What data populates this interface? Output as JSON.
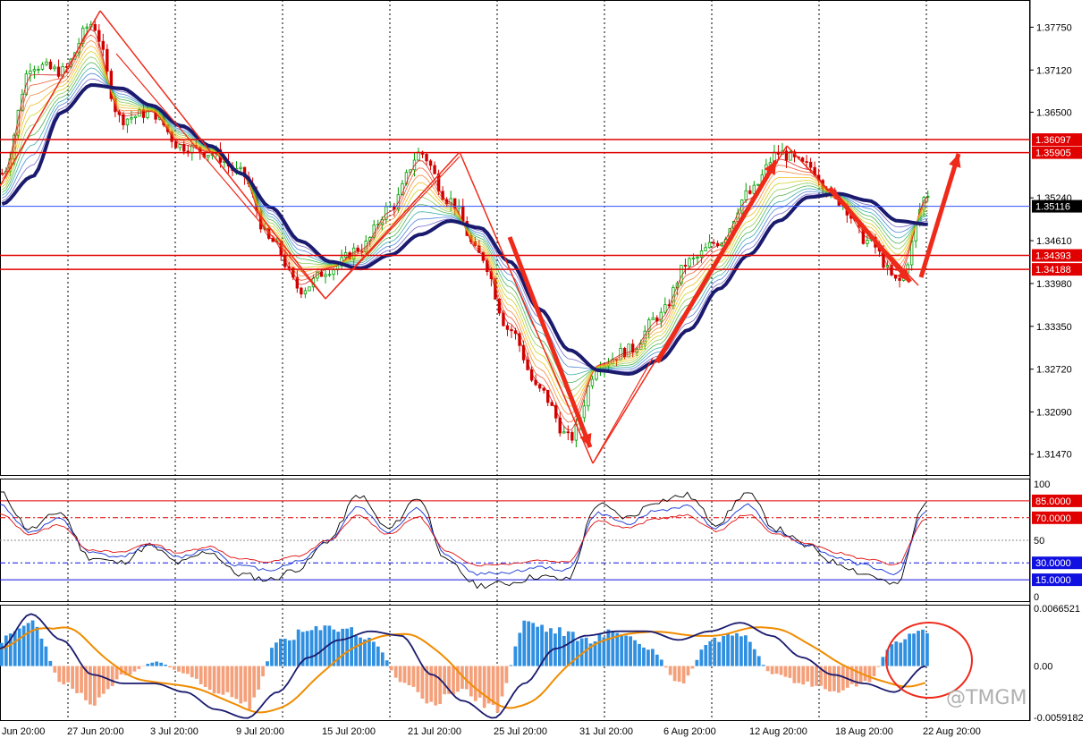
{
  "chart_data": [
    {
      "type": "candlestick",
      "panel": "price",
      "ylim": [
        1.3115,
        1.3815
      ],
      "y_ticks": [
        "1.37750",
        "1.37120",
        "1.36500",
        "1.35240",
        "1.34610",
        "1.33980",
        "1.33350",
        "1.32720",
        "1.32090",
        "1.31470"
      ],
      "horizontal_levels": [
        {
          "value": 1.36097,
          "label": "1.36097",
          "color": "#e00000"
        },
        {
          "value": 1.35905,
          "label": "1.35905",
          "color": "#e00000"
        },
        {
          "value": 1.35116,
          "label": "1.35116",
          "color": "#000000",
          "line_color": "#3050ff"
        },
        {
          "value": 1.34393,
          "label": "1.34393",
          "color": "#e00000"
        },
        {
          "value": 1.34188,
          "label": "1.34188",
          "color": "#e00000"
        }
      ],
      "ma_anchor_values": [
        1.3515,
        1.3555,
        1.365,
        1.369,
        1.3685,
        1.366,
        1.363,
        1.36,
        1.356,
        1.351,
        1.346,
        1.343,
        1.342,
        1.344,
        1.347,
        1.349,
        1.348,
        1.343,
        1.336,
        1.33,
        1.327,
        1.3265,
        1.3285,
        1.333,
        1.339,
        1.344,
        1.349,
        1.3525,
        1.353,
        1.352,
        1.349,
        1.3485
      ],
      "close_anchor_values": [
        1.356,
        1.372,
        1.371,
        1.378,
        1.364,
        1.365,
        1.36,
        1.359,
        1.356,
        1.346,
        1.339,
        1.342,
        1.345,
        1.351,
        1.359,
        1.352,
        1.344,
        1.333,
        1.324,
        1.317,
        1.328,
        1.33,
        1.335,
        1.343,
        1.346,
        1.353,
        1.359,
        1.357,
        1.352,
        1.346,
        1.34,
        1.353
      ]
    },
    {
      "type": "line",
      "panel": "oscillator",
      "ylim": [
        0,
        100
      ],
      "y_ticks": [
        "100",
        "50",
        "0"
      ],
      "levels": [
        {
          "value": 85,
          "label": "85.0000",
          "color": "#e00000"
        },
        {
          "value": 70,
          "label": "70.0000",
          "color": "#e00000"
        },
        {
          "value": 30,
          "label": "30.0000",
          "color": "#1010e0"
        },
        {
          "value": 15,
          "label": "15.0000",
          "color": "#1010e0"
        }
      ],
      "series_anchor_values": [
        92,
        60,
        75,
        35,
        30,
        45,
        30,
        40,
        20,
        15,
        25,
        50,
        90,
        60,
        88,
        30,
        10,
        12,
        18,
        15,
        82,
        70,
        85,
        90,
        65,
        92,
        60,
        45,
        30,
        20,
        10,
        85
      ]
    },
    {
      "type": "bar",
      "panel": "macd",
      "ylim": [
        -0.0059182,
        0.0066521
      ],
      "y_ticks": [
        "0.0066521",
        "0.00",
        "-0.0059182"
      ],
      "histogram_anchor_values": [
        0.003,
        0.005,
        -0.002,
        -0.004,
        -0.001,
        0.0005,
        -0.001,
        -0.003,
        -0.0045,
        0.003,
        0.004,
        0.0045,
        0.003,
        -0.002,
        -0.004,
        -0.003,
        -0.005,
        0.005,
        0.004,
        0.003,
        0.004,
        0.002,
        -0.002,
        0.003,
        0.004,
        -0.001,
        -0.002,
        -0.003,
        -0.002,
        0.003,
        0.004
      ]
    }
  ],
  "x_labels": [
    "Jun 20:00",
    "27 Jun 20:00",
    "3 Jul 20:00",
    "9 Jul 20:00",
    "15 Jul 20:00",
    "21 Jul 20:00",
    "25 Jul 20:00",
    "31 Jul 20:00",
    "6 Aug 20:00",
    "12 Aug 20:00",
    "18 Aug 20:00",
    "22 Aug 20:00"
  ],
  "watermark": "@TMGM",
  "colors": {
    "up": "#00a000",
    "down": "#d00000",
    "ma_slow": "#1a1a6e",
    "signal": "#f08c00",
    "hist_pos": "#2f8fe0",
    "hist_neg": "#f4a07a",
    "arrow": "#ee2a1a"
  }
}
